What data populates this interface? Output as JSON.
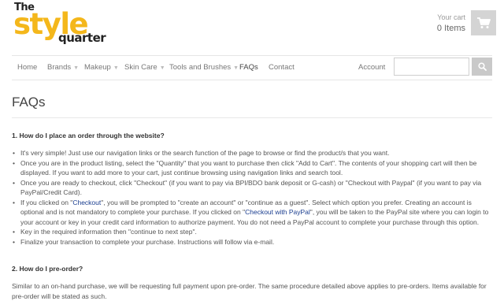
{
  "brand": {
    "the": "The",
    "style": "style",
    "quarter": "quarter"
  },
  "cart": {
    "label": "Your cart",
    "count": "0 Items"
  },
  "nav": {
    "home": "Home",
    "brands": "Brands",
    "makeup": "Makeup",
    "skin_care": "Skin Care",
    "tools": "Tools and Brushes",
    "faqs": "FAQs",
    "contact": "Contact",
    "account": "Account",
    "caret": "▼"
  },
  "search": {
    "placeholder": ""
  },
  "page_title": "FAQs",
  "faq": {
    "q1": "1. How do I place an order through the website?",
    "b1": "It's very simple! Just use our navigation links or the search function of the page to browse or find the product/s that you want.",
    "b2": "Once you are in the product listing, select the \"Quantity\" that you want to purchase then click \"Add to Cart\". The contents of your shopping cart will then be displayed. If you want to add more to your cart, just continue browsing using navigation links and search tool.",
    "b3": "Once you are ready to checkout, click \"Checkout\" (if you want to pay via BPI/BDO bank deposit or G-cash) or \"Checkout with Paypal\" (if you want to pay via PayPal/Credit Card).",
    "b4_pre": "If you clicked on \"",
    "b4_link1": "Checkout",
    "b4_mid": "\", you will be prompted to \"create an account\" or \"continue as a guest\". Select which option you prefer. Creating an account is optional and is not mandatory to complete your purchase. If you clicked on \"",
    "b4_link2": "Checkout with PayPal",
    "b4_post": "\", you will be taken to the PayPal site where you can login to your account or key in your credit card information to authorize payment. You do not need a PayPal account to complete your purchase through this option.",
    "b5": "Key in the required information then \"continue to next step\".",
    "b6": "Finalize your transaction to complete your purchase. Instructions will follow via e-mail.",
    "q2": "2. How do I pre-order?",
    "a2": "Similar to an on-hand purchase, we will be requesting full payment upon pre-order. The same procedure detailed above applies to pre-orders. Items available for pre-order will be stated as such."
  },
  "icons": {
    "cart": "shopping-cart-icon",
    "search": "search-icon"
  }
}
